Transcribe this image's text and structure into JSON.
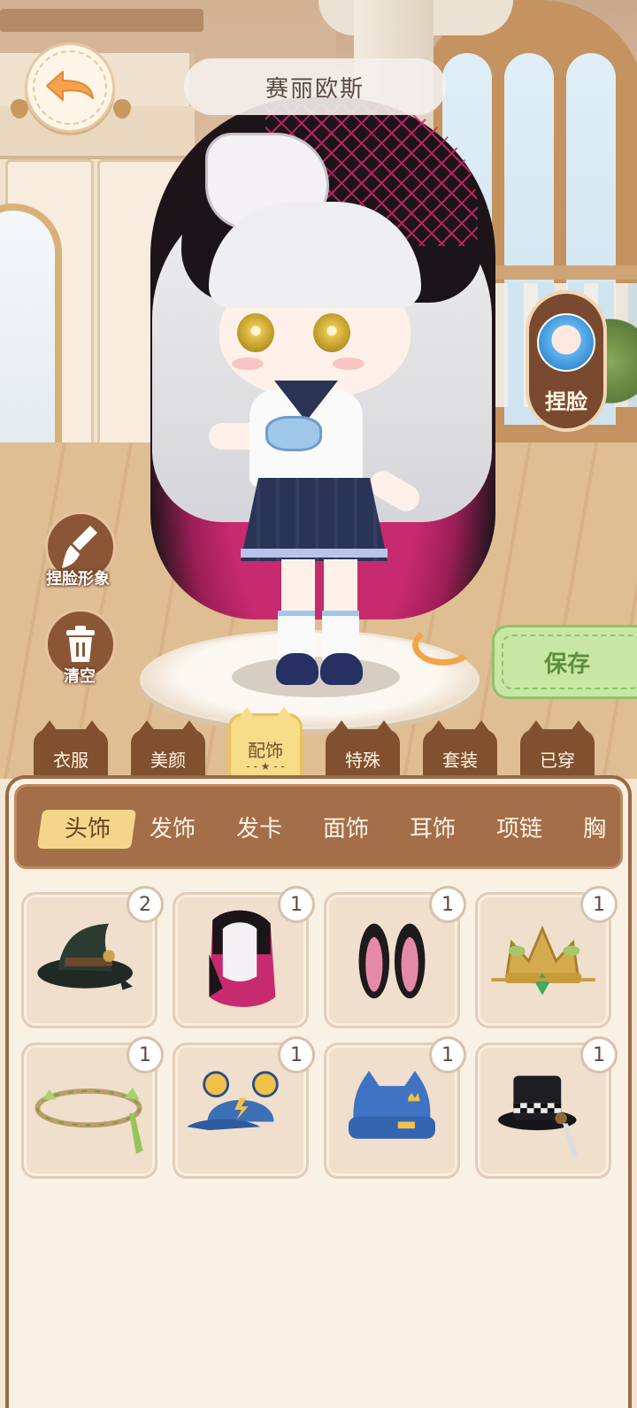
{
  "character": {
    "name": "赛丽欧斯"
  },
  "buttons": {
    "pinch_face": "捏脸",
    "pinch_appearance": "捏脸形象",
    "clear": "清空",
    "save": "保存"
  },
  "category_tabs": [
    {
      "label": "衣服"
    },
    {
      "label": "美颜"
    },
    {
      "label": "配饰",
      "active": true
    },
    {
      "label": "特殊"
    },
    {
      "label": "套装"
    },
    {
      "label": "已穿"
    }
  ],
  "subtabs": [
    {
      "label": "头饰",
      "active": true
    },
    {
      "label": "发饰"
    },
    {
      "label": "发卡"
    },
    {
      "label": "面饰"
    },
    {
      "label": "耳饰"
    },
    {
      "label": "项链"
    },
    {
      "label": "胸"
    }
  ],
  "items": [
    {
      "icon": "witch-hat-icon",
      "count": "2"
    },
    {
      "icon": "black-lace-veil-icon",
      "count": "1"
    },
    {
      "icon": "bunny-ears-icon",
      "count": "1"
    },
    {
      "icon": "golden-crown-icon",
      "count": "1"
    },
    {
      "icon": "vine-wreath-icon",
      "count": "1"
    },
    {
      "icon": "bear-cap-icon",
      "count": "1"
    },
    {
      "icon": "cat-beanie-icon",
      "count": "1"
    },
    {
      "icon": "top-hat-icon",
      "count": "1"
    }
  ],
  "colors": {
    "panel_brown": "#a36e48",
    "active_tab": "#f5dd8a",
    "save_green": "#c9e7a4"
  }
}
